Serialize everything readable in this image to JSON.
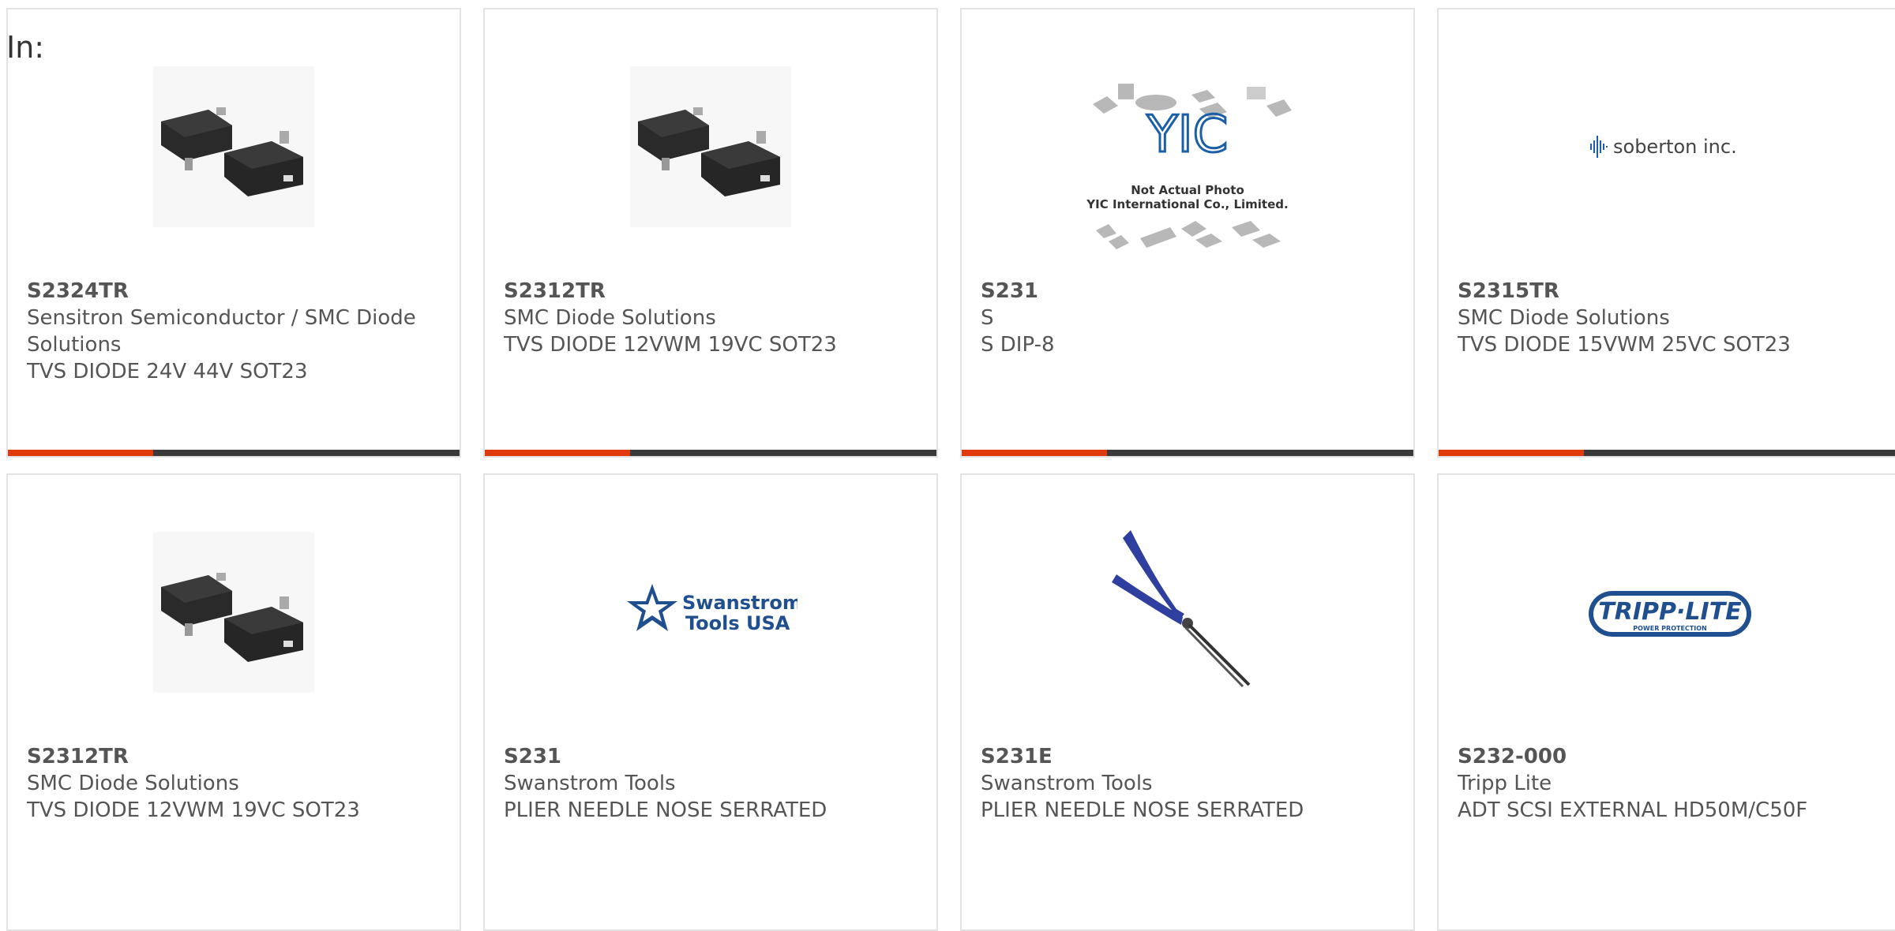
{
  "filter_prefix": "In:",
  "rows": [
    [
      {
        "part": "S2324TR",
        "maker": "Sensitron Semiconductor / SMC Diode Solutions",
        "desc": "TVS DIODE 24V 44V SOT23",
        "image": "sot23-package-photo"
      },
      {
        "part": "S2312TR",
        "maker": "SMC Diode Solutions",
        "desc": "TVS DIODE 12VWM 19VC SOT23",
        "image": "sot23-package-photo"
      },
      {
        "part": "S231",
        "maker": "S",
        "desc": "S DIP-8",
        "image": "yic-not-actual-photo",
        "image_caption": [
          "Not Actual Photo",
          "YIC International Co., Limited."
        ],
        "logo_text": "YIC"
      },
      {
        "part": "S2315TR",
        "maker": "SMC Diode Solutions",
        "desc": "TVS DIODE 15VWM 25VC SOT23",
        "image": "soberton-logo",
        "logo_text": "soberton inc."
      }
    ],
    [
      {
        "part": "S2312TR",
        "maker": "SMC Diode Solutions",
        "desc": "TVS DIODE 12VWM 19VC SOT23",
        "image": "sot23-package-photo"
      },
      {
        "part": "S231",
        "maker": "Swanstrom Tools",
        "desc": "PLIER NEEDLE NOSE SERRATED",
        "image": "swanstrom-logo",
        "logo_text": [
          "Swanstrom",
          "Tools USA"
        ]
      },
      {
        "part": "S231E",
        "maker": "Swanstrom Tools",
        "desc": "PLIER NEEDLE NOSE SERRATED",
        "image": "needle-nose-plier-photo"
      },
      {
        "part": "S232-000",
        "maker": "Tripp Lite",
        "desc": "ADT SCSI EXTERNAL HD50M/C50F",
        "image": "tripp-lite-logo",
        "logo_text": [
          "TRIPP·LITE",
          "POWER PROTECTION"
        ]
      }
    ]
  ],
  "colors": {
    "accent": "#e03a0d",
    "bar": "#3a3a3a",
    "text": "#555555",
    "border": "#e3e3e3",
    "link_blue": "#1a5fa8"
  }
}
